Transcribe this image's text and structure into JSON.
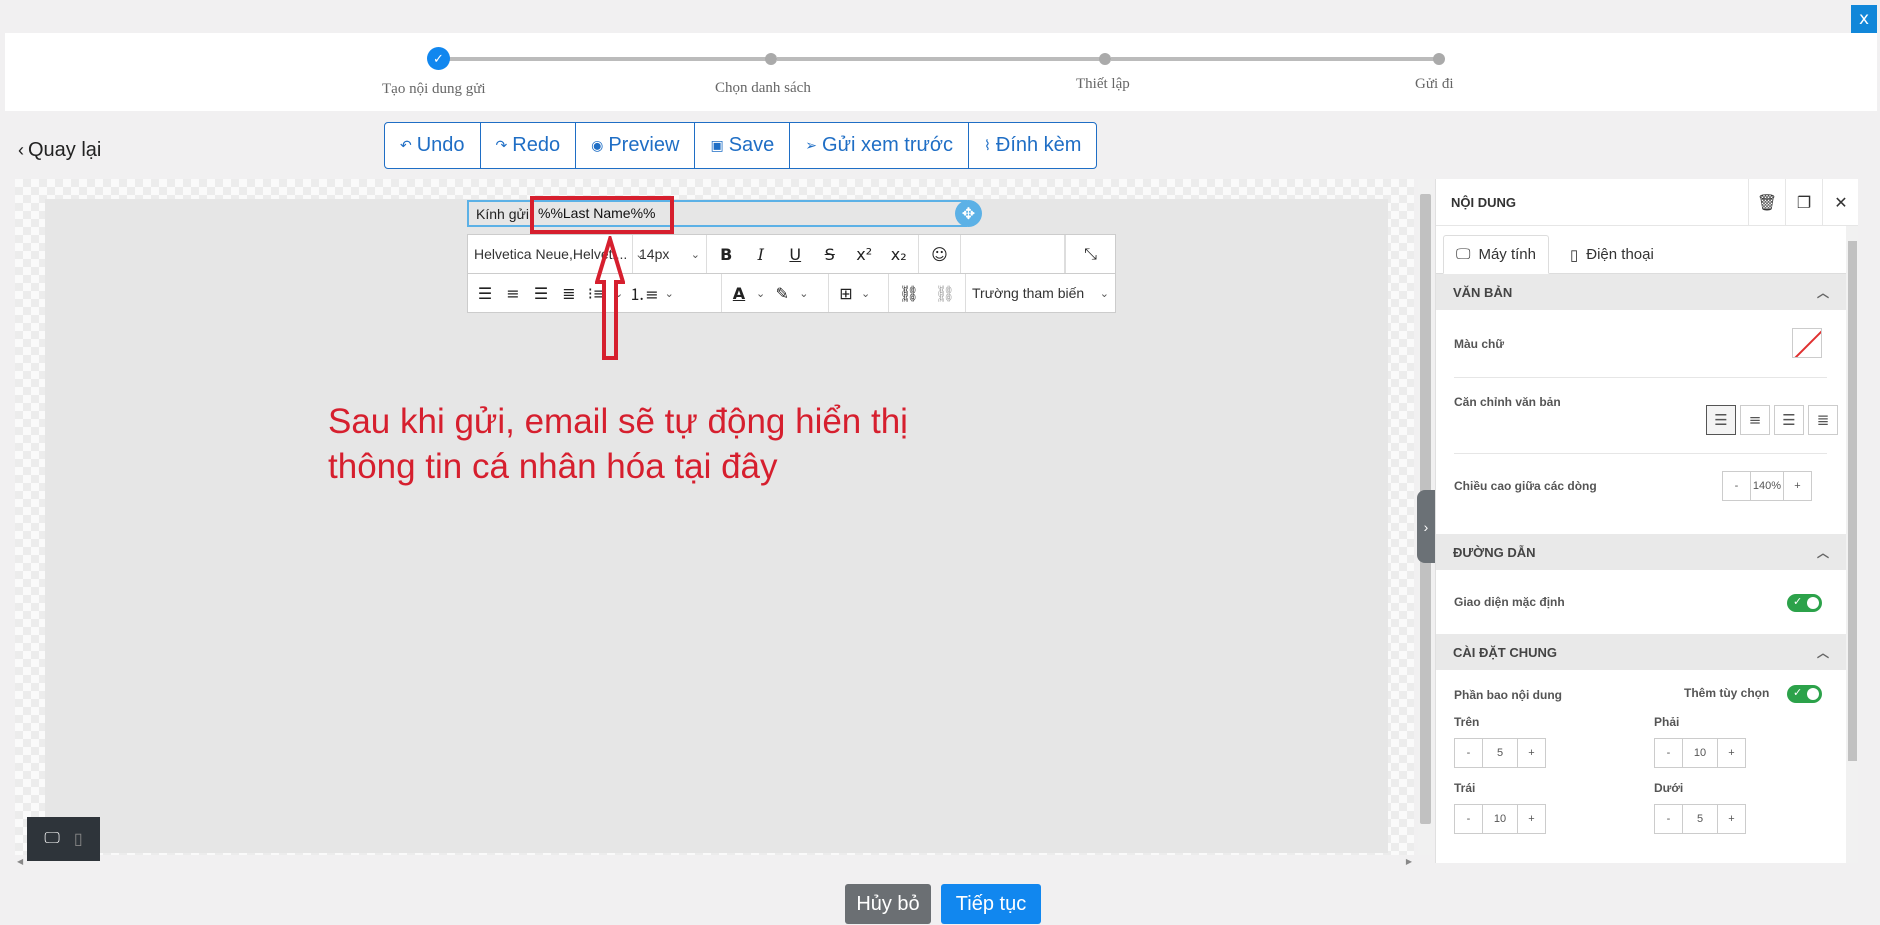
{
  "close_button": "x",
  "steps": [
    "Tạo nội dung gửi",
    "Chọn danh sách",
    "Thiết lập",
    "Gửi đi"
  ],
  "back_label": "Quay lại",
  "toolbar": {
    "undo": "Undo",
    "redo": "Redo",
    "preview": "Preview",
    "save": "Save",
    "send_preview": "Gửi xem trước",
    "attach": "Đính kèm"
  },
  "editor": {
    "greeting": "Kính gửi",
    "merge_tag": "%%Last Name%%",
    "font_family": "Helvetica Neue,Helveti...",
    "font_size": "14px",
    "merge_fields_dropdown": "Trường tham biến",
    "annotation_line1": "Sau khi gửi, email sẽ tự động hiển thị",
    "annotation_line2": "thông tin cá nhân hóa tại đây"
  },
  "panel": {
    "title": "NỘI DUNG",
    "tab_desktop": "Máy tính",
    "tab_mobile": "Điện thoại",
    "section_text": "VĂN BẢN",
    "text_color_label": "Màu chữ",
    "text_align_label": "Căn chỉnh văn bản",
    "line_height_label": "Chiều cao giữa các dòng",
    "line_height_value": "140%",
    "section_link": "ĐƯỜNG DẪN",
    "default_style_label": "Giao diện mặc định",
    "default_style_on": true,
    "section_general": "CÀI ĐẶT CHUNG",
    "padding_label": "Phần bao nội dung",
    "more_options_label": "Thêm tùy chọn",
    "more_options_on": true,
    "top_label": "Trên",
    "top_value": "5",
    "right_label": "Phải",
    "right_value": "10",
    "left_label": "Trái",
    "left_value": "10",
    "bottom_label": "Dưới",
    "bottom_value": "5",
    "minus": "-",
    "plus": "+"
  },
  "footer": {
    "cancel": "Hủy bỏ",
    "next": "Tiếp tục"
  },
  "colors": {
    "accent": "#1187ef",
    "annotation_red": "#d61f2e",
    "toggle_green": "#2ca24a"
  }
}
